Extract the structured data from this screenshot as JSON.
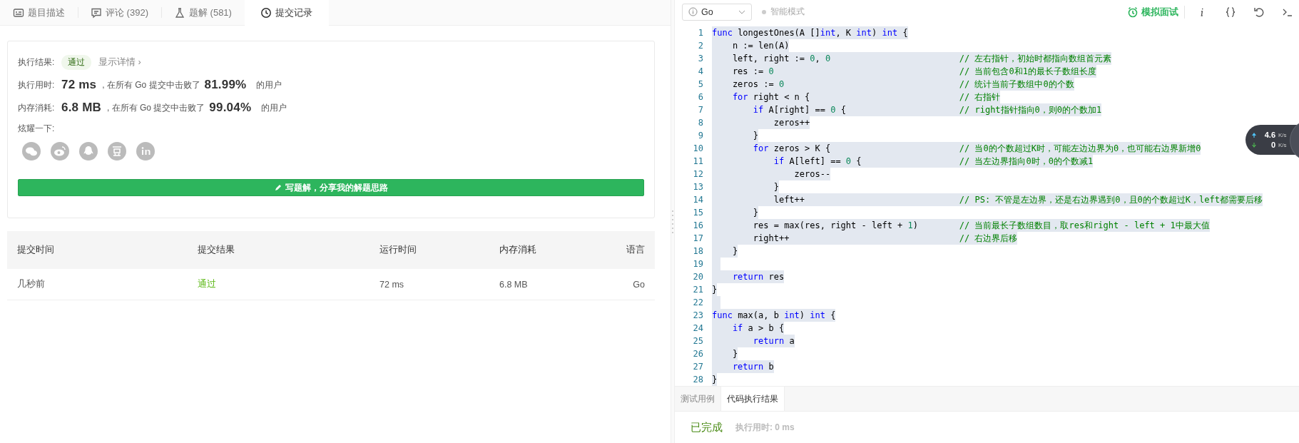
{
  "left_tabs": [
    {
      "kind": "description",
      "label": "题目描述",
      "selected": false
    },
    {
      "kind": "comments",
      "label": "评论 (392)",
      "selected": false
    },
    {
      "kind": "solutions",
      "label": "题解 (581)",
      "selected": false
    },
    {
      "kind": "submissions",
      "label": "提交记录",
      "selected": true
    }
  ],
  "result_card": {
    "result_label": "执行结果:",
    "result": "通过",
    "details_link": "显示详情 ›",
    "stats": [
      {
        "label": "执行用时:",
        "value": "72 ms",
        "middle": ", 在所有 Go 提交中击败了",
        "percent": "81.99%",
        "suffix": "的用户"
      },
      {
        "label": "内存消耗:",
        "value": "6.8 MB",
        "middle": ", 在所有 Go 提交中击败了",
        "percent": "99.04%",
        "suffix": "的用户"
      }
    ],
    "share_label": "炫耀一下:",
    "share_icons": [
      {
        "kind": "wechat"
      },
      {
        "kind": "weibo"
      },
      {
        "kind": "qq"
      },
      {
        "kind": "douban"
      },
      {
        "kind": "linkedin"
      }
    ],
    "write_button": "写题解，分享我的解题思路"
  },
  "table": {
    "columns": [
      "提交时间",
      "提交结果",
      "运行时间",
      "内存消耗",
      "语言"
    ],
    "rows": [
      {
        "cells": [
          "几秒前",
          "通过",
          "72 ms",
          "6.8 MB",
          "Go"
        ]
      }
    ]
  },
  "toolbar": {
    "language": "Go",
    "smart_mode": {
      "label": "智能模式",
      "on": false
    },
    "interview": "模拟面试",
    "tools": [
      {
        "kind": "info"
      },
      {
        "kind": "braces"
      },
      {
        "kind": "reset"
      },
      {
        "kind": "console"
      }
    ]
  },
  "code_lines": [
    {
      "num": "1",
      "tokens": [
        {
          "kind": "kw",
          "text": "func"
        },
        {
          "kind": "plain",
          "text": " longestOnes(A []"
        },
        {
          "kind": "kw",
          "text": "int"
        },
        {
          "kind": "plain",
          "text": ", K "
        },
        {
          "kind": "kw",
          "text": "int"
        },
        {
          "kind": "plain",
          "text": ") "
        },
        {
          "kind": "kw",
          "text": "int"
        },
        {
          "kind": "plain",
          "text": " {"
        }
      ]
    },
    {
      "num": "2",
      "tokens": [
        {
          "kind": "plain",
          "text": "    n := len(A)"
        }
      ]
    },
    {
      "num": "3",
      "tokens": [
        {
          "kind": "plain",
          "text": "    left, right := "
        },
        {
          "kind": "num",
          "text": "0"
        },
        {
          "kind": "plain",
          "text": ", "
        },
        {
          "kind": "num",
          "text": "0"
        }
      ],
      "comment": "// 左右指针，初始时都指向数组首元素"
    },
    {
      "num": "4",
      "tokens": [
        {
          "kind": "plain",
          "text": "    res := "
        },
        {
          "kind": "num",
          "text": "0"
        }
      ],
      "comment": "// 当前包含0和1的最长子数组长度"
    },
    {
      "num": "5",
      "tokens": [
        {
          "kind": "plain",
          "text": "    zeros := "
        },
        {
          "kind": "num",
          "text": "0"
        }
      ],
      "comment": "// 统计当前子数组中0的个数"
    },
    {
      "num": "6",
      "tokens": [
        {
          "kind": "kw",
          "text": "    for"
        },
        {
          "kind": "plain",
          "text": " right < n {"
        }
      ],
      "comment": "// 右指针"
    },
    {
      "num": "7",
      "tokens": [
        {
          "kind": "kw",
          "text": "        if"
        },
        {
          "kind": "plain",
          "text": " A[right] == "
        },
        {
          "kind": "num",
          "text": "0"
        },
        {
          "kind": "plain",
          "text": " {"
        }
      ],
      "comment": "// right指针指向0，则0的个数加1"
    },
    {
      "num": "8",
      "tokens": [
        {
          "kind": "plain",
          "text": "            zeros++"
        }
      ]
    },
    {
      "num": "9",
      "tokens": [
        {
          "kind": "plain",
          "text": "        }"
        }
      ]
    },
    {
      "num": "10",
      "tokens": [
        {
          "kind": "kw",
          "text": "        for"
        },
        {
          "kind": "plain",
          "text": " zeros > K {"
        }
      ],
      "comment": "// 当0的个数超过K时，可能左边边界为0，也可能右边界新增0"
    },
    {
      "num": "11",
      "tokens": [
        {
          "kind": "kw",
          "text": "            if"
        },
        {
          "kind": "plain",
          "text": " A[left] == "
        },
        {
          "kind": "num",
          "text": "0"
        },
        {
          "kind": "plain",
          "text": " {"
        }
      ],
      "comment": "// 当左边界指向0时，0的个数减1"
    },
    {
      "num": "12",
      "tokens": [
        {
          "kind": "plain",
          "text": "                zeros--"
        }
      ]
    },
    {
      "num": "13",
      "tokens": [
        {
          "kind": "plain",
          "text": "            }"
        }
      ]
    },
    {
      "num": "14",
      "tokens": [
        {
          "kind": "plain",
          "text": "            left++"
        }
      ],
      "comment": "// PS: 不管是左边界，还是右边界遇到0，且0的个数超过K，left都需要后移"
    },
    {
      "num": "15",
      "tokens": [
        {
          "kind": "plain",
          "text": "        }"
        }
      ]
    },
    {
      "num": "16",
      "tokens": [
        {
          "kind": "plain",
          "text": "        res = max(res, right - left + "
        },
        {
          "kind": "num",
          "text": "1"
        },
        {
          "kind": "plain",
          "text": ")"
        }
      ],
      "comment": "// 当前最长子数组数目，取res和right - left + 1中最大值"
    },
    {
      "num": "17",
      "tokens": [
        {
          "kind": "plain",
          "text": "        right++"
        }
      ],
      "comment": "// 右边界后移"
    },
    {
      "num": "18",
      "tokens": [
        {
          "kind": "plain",
          "text": "    }"
        }
      ]
    },
    {
      "num": "19"
    },
    {
      "num": "20",
      "tokens": [
        {
          "kind": "kw",
          "text": "    return"
        },
        {
          "kind": "plain",
          "text": " res"
        }
      ]
    },
    {
      "num": "21",
      "tokens": [
        {
          "kind": "plain",
          "text": "}"
        }
      ]
    },
    {
      "num": "22"
    },
    {
      "num": "23",
      "tokens": [
        {
          "kind": "kw",
          "text": "func"
        },
        {
          "kind": "plain",
          "text": " max(a, b "
        },
        {
          "kind": "kw",
          "text": "int"
        },
        {
          "kind": "plain",
          "text": ") "
        },
        {
          "kind": "kw",
          "text": "int"
        },
        {
          "kind": "plain",
          "text": " {"
        }
      ]
    },
    {
      "num": "24",
      "tokens": [
        {
          "kind": "kw",
          "text": "    if"
        },
        {
          "kind": "plain",
          "text": " a > b {"
        }
      ]
    },
    {
      "num": "25",
      "tokens": [
        {
          "kind": "kw",
          "text": "        return"
        },
        {
          "kind": "plain",
          "text": " a"
        }
      ]
    },
    {
      "num": "26",
      "tokens": [
        {
          "kind": "plain",
          "text": "    }"
        }
      ]
    },
    {
      "num": "27",
      "tokens": [
        {
          "kind": "kw",
          "text": "    return"
        },
        {
          "kind": "plain",
          "text": " b"
        }
      ]
    },
    {
      "num": "28",
      "tokens": [
        {
          "kind": "plain",
          "text": "}"
        }
      ]
    }
  ],
  "result_tabs": [
    {
      "label": "测试用例",
      "selected": false
    },
    {
      "label": "代码执行结果",
      "selected": true
    }
  ],
  "run_result": {
    "status": "已完成",
    "time": "执行用时: 0 ms"
  },
  "net_speed": {
    "upload": "4.6",
    "upload_unit": "K/s",
    "download": "0",
    "download_unit": "K/s"
  }
}
